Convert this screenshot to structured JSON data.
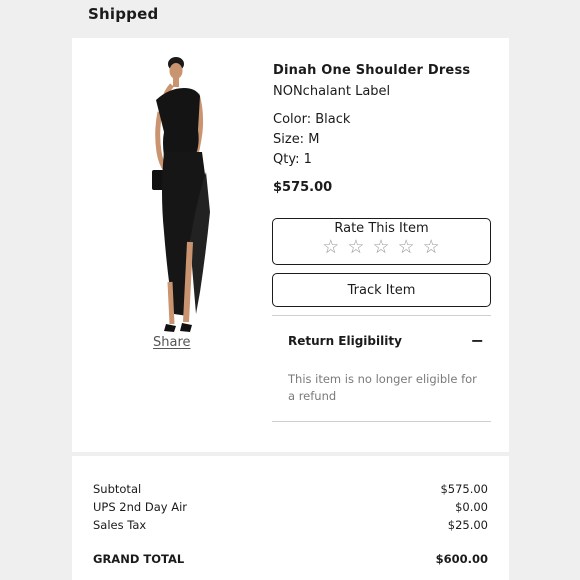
{
  "order": {
    "status": "Shipped"
  },
  "item": {
    "name": "Dinah One Shoulder Dress",
    "brand": "NONchalant Label",
    "color": "Color: Black",
    "size": "Size: M",
    "qty": "Qty: 1",
    "price": "$575.00",
    "share_label": "Share",
    "image_icon": "black-one-shoulder-dress-photo"
  },
  "rating": {
    "label": "Rate This Item",
    "max_stars": 5,
    "selected": 0,
    "star_glyph": "☆"
  },
  "track": {
    "label": "Track Item"
  },
  "return_eligibility": {
    "title": "Return Eligibility",
    "toggle_glyph": "−",
    "message": "This item is no longer eligible for a refund"
  },
  "summary": {
    "subtotal_label": "Subtotal",
    "subtotal_value": "$575.00",
    "shipping_label": "UPS 2nd Day Air",
    "shipping_value": "$0.00",
    "tax_label": "Sales Tax",
    "tax_value": "$25.00",
    "grand_total_label": "GRAND TOTAL",
    "grand_total_value": "$600.00"
  }
}
